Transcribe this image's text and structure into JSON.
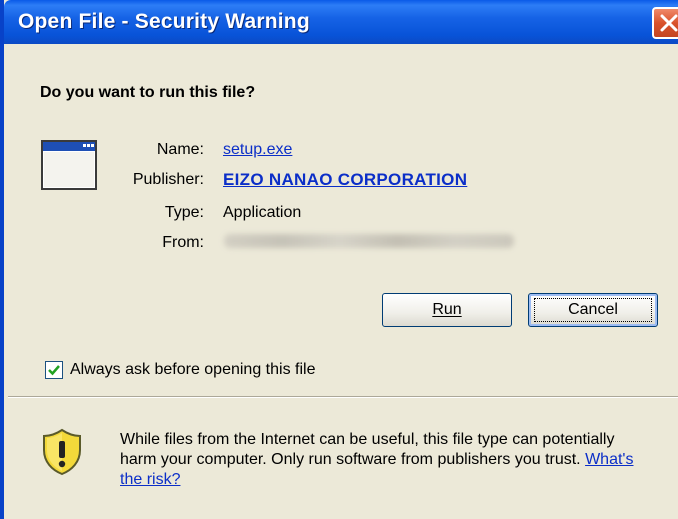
{
  "window": {
    "title": "Open File - Security Warning",
    "close_icon": "close-icon"
  },
  "prompt": {
    "question": "Do you want to run this file?"
  },
  "file": {
    "icon": "application-window-icon",
    "name_label": "Name:",
    "name_value": "setup.exe",
    "publisher_label": "Publisher:",
    "publisher_value": "EIZO NANAO CORPORATION",
    "type_label": "Type:",
    "type_value": "Application",
    "from_label": "From:"
  },
  "buttons": {
    "run_label": "Run",
    "cancel_label": "Cancel"
  },
  "checkbox": {
    "label": "Always ask before opening this file",
    "checked": true
  },
  "warning": {
    "icon": "shield-warning-icon",
    "text": "While files from the Internet can be useful, this file type can potentially harm your computer. Only run software from publishers you trust.",
    "link": "What's the risk?"
  },
  "colors": {
    "titlebar": "#0a5ae8",
    "dialog_bg": "#ece9d8",
    "link": "#0b2ec8",
    "close_button": "#d9532c"
  }
}
